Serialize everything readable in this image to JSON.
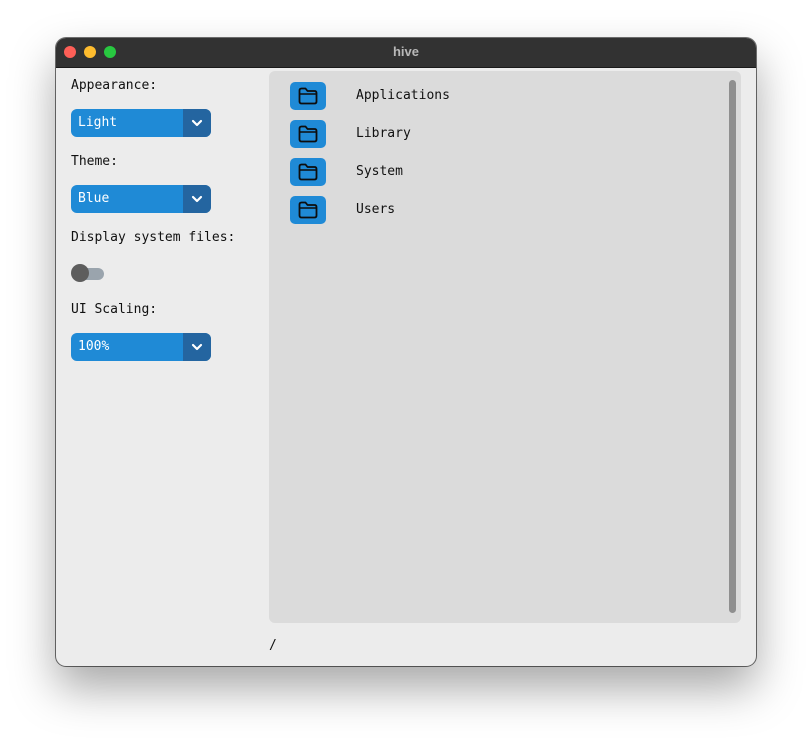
{
  "window": {
    "title": "hive"
  },
  "sidebar": {
    "appearance": {
      "label": "Appearance:",
      "value": "Light"
    },
    "theme": {
      "label": "Theme:",
      "value": "Blue"
    },
    "system_files": {
      "label": "Display system files:",
      "enabled": false
    },
    "ui_scaling": {
      "label": "UI Scaling:",
      "value": "100%"
    }
  },
  "browser": {
    "items": [
      {
        "name": "Applications",
        "icon": "folder-icon"
      },
      {
        "name": "Library",
        "icon": "folder-icon"
      },
      {
        "name": "System",
        "icon": "folder-icon"
      },
      {
        "name": "Users",
        "icon": "folder-icon"
      }
    ]
  },
  "status": {
    "path": "/"
  },
  "colors": {
    "accent": "#1f8ad6",
    "accent_dark": "#2465a0"
  }
}
